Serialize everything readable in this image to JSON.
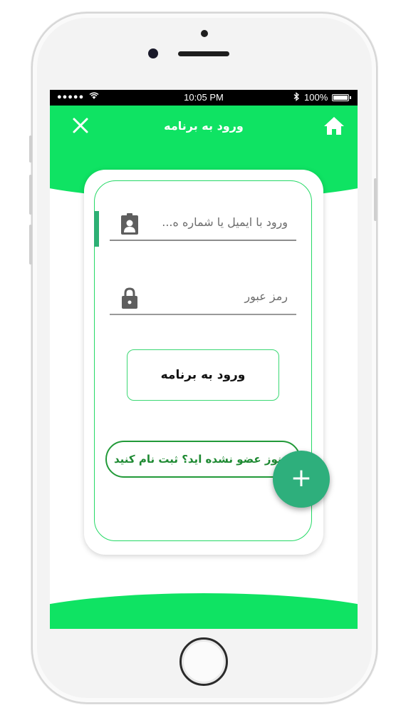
{
  "status_bar": {
    "signal": "●●●●●",
    "time": "10:05 PM",
    "battery_percent": "100%"
  },
  "header": {
    "title": "ورود به برنامه",
    "close_icon": "close-icon",
    "home_icon": "home-icon"
  },
  "form": {
    "email_placeholder": "ورود با ایمیل یا شماره ه...",
    "password_placeholder": "رمز عبور",
    "login_label": "ورود به برنامه",
    "register_text": "هنوز عضو نشده اید؟ ثبت نام کنید"
  },
  "fab": {
    "label": "+"
  },
  "colors": {
    "primary_green": "#0fe363",
    "fab_teal": "#2eaf7c",
    "link_green": "#1f8a33"
  }
}
